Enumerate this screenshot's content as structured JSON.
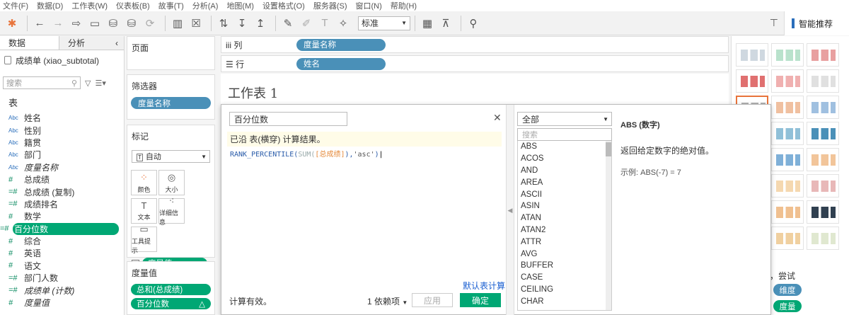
{
  "menu": [
    "文件(F)",
    "数据(D)",
    "工作表(W)",
    "仪表板(B)",
    "故事(T)",
    "分析(A)",
    "地图(M)",
    "设置格式(O)",
    "服务器(S)",
    "窗口(N)",
    "帮助(H)"
  ],
  "toolbar": {
    "fit_select": "标准",
    "smart_label": "智能推荐"
  },
  "left": {
    "tab_data": "数据",
    "tab_analysis": "分析",
    "datasource": "成绩单 (xiao_subtotal)",
    "search_placeholder": "搜索",
    "section_tables": "表",
    "fields": [
      {
        "type": "Abc",
        "name": "姓名"
      },
      {
        "type": "Abc",
        "name": "性别"
      },
      {
        "type": "Abc",
        "name": "籍贯"
      },
      {
        "type": "Abc",
        "name": "部门"
      },
      {
        "type": "Abc",
        "name": "度量名称"
      },
      {
        "type": "#",
        "name": "总成绩"
      },
      {
        "type": "=#",
        "name": "总成绩 (复制)"
      },
      {
        "type": "=#",
        "name": "成绩排名"
      },
      {
        "type": "#",
        "name": "数学"
      },
      {
        "type": "=#",
        "name": "百分位数"
      },
      {
        "type": "#",
        "name": "综合"
      },
      {
        "type": "#",
        "name": "英语"
      },
      {
        "type": "#",
        "name": "语文"
      },
      {
        "type": "=#",
        "name": "部门人数"
      },
      {
        "type": "=#",
        "name": "成绩单 (计数)"
      },
      {
        "type": "#",
        "name": "度量值"
      }
    ]
  },
  "cards": {
    "pages": "页面",
    "filters": "筛选器",
    "filter_pill": "度量名称",
    "marks": "标记",
    "marks_type": "自动",
    "mark_buttons": [
      {
        "icon": "color-icon",
        "label": "颜色"
      },
      {
        "icon": "size-icon",
        "label": "大小"
      },
      {
        "icon": "text-icon",
        "label": "文本"
      },
      {
        "icon": "detail-icon",
        "label": "详细信息"
      },
      {
        "icon": "tooltip-icon",
        "label": "工具提示"
      }
    ],
    "marks_pill": "度量值",
    "measure_values": "度量值",
    "measure_pills": [
      "总和(总成绩)",
      "百分位数"
    ]
  },
  "shelves": {
    "columns_label": "列",
    "columns_pill": "度量名称",
    "rows_label": "行",
    "rows_pill": "姓名",
    "sheet_title": "工作表 1"
  },
  "calc": {
    "name": "百分位数",
    "info": "已沿 表(横穿) 计算结果。",
    "formula_fn": "RANK_PERCENTILE(",
    "formula_agg": "SUM(",
    "formula_field": "[总成绩]",
    "formula_close": "),",
    "formula_arg": "'asc'",
    "formula_end": ")",
    "default_calc": "默认表计算",
    "status": "计算有效。",
    "dependencies": "1 依赖项",
    "apply": "应用",
    "ok": "确定",
    "fn_category": "全部",
    "fn_search": "搜索",
    "functions": [
      "ABS",
      "ACOS",
      "AND",
      "AREA",
      "ASCII",
      "ASIN",
      "ATAN",
      "ATAN2",
      "ATTR",
      "AVG",
      "BUFFER",
      "CASE",
      "CEILING",
      "CHAR"
    ],
    "help_title": "ABS (数字)",
    "help_desc": "返回给定数字的绝对值。",
    "help_example": "示例: ABS(-7) = 7"
  },
  "showme": {
    "try_label": "，尝试",
    "pills": [
      {
        "label": "维度",
        "color": "#4a90b8"
      },
      {
        "label": "度量",
        "color": "#00a774"
      }
    ]
  }
}
